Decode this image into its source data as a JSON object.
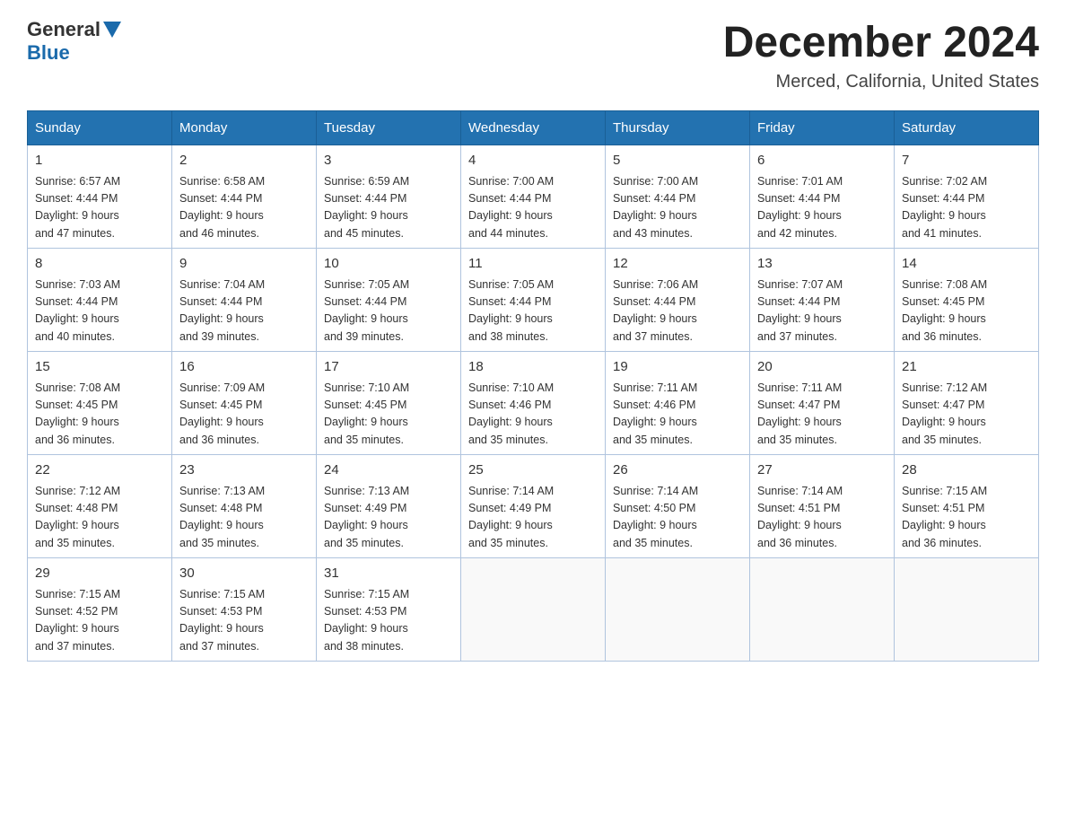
{
  "header": {
    "logo_general": "General",
    "logo_blue": "Blue",
    "month_title": "December 2024",
    "location": "Merced, California, United States"
  },
  "days_of_week": [
    "Sunday",
    "Monday",
    "Tuesday",
    "Wednesday",
    "Thursday",
    "Friday",
    "Saturday"
  ],
  "weeks": [
    [
      {
        "day": "1",
        "sunrise": "6:57 AM",
        "sunset": "4:44 PM",
        "daylight": "9 hours and 47 minutes."
      },
      {
        "day": "2",
        "sunrise": "6:58 AM",
        "sunset": "4:44 PM",
        "daylight": "9 hours and 46 minutes."
      },
      {
        "day": "3",
        "sunrise": "6:59 AM",
        "sunset": "4:44 PM",
        "daylight": "9 hours and 45 minutes."
      },
      {
        "day": "4",
        "sunrise": "7:00 AM",
        "sunset": "4:44 PM",
        "daylight": "9 hours and 44 minutes."
      },
      {
        "day": "5",
        "sunrise": "7:00 AM",
        "sunset": "4:44 PM",
        "daylight": "9 hours and 43 minutes."
      },
      {
        "day": "6",
        "sunrise": "7:01 AM",
        "sunset": "4:44 PM",
        "daylight": "9 hours and 42 minutes."
      },
      {
        "day": "7",
        "sunrise": "7:02 AM",
        "sunset": "4:44 PM",
        "daylight": "9 hours and 41 minutes."
      }
    ],
    [
      {
        "day": "8",
        "sunrise": "7:03 AM",
        "sunset": "4:44 PM",
        "daylight": "9 hours and 40 minutes."
      },
      {
        "day": "9",
        "sunrise": "7:04 AM",
        "sunset": "4:44 PM",
        "daylight": "9 hours and 39 minutes."
      },
      {
        "day": "10",
        "sunrise": "7:05 AM",
        "sunset": "4:44 PM",
        "daylight": "9 hours and 39 minutes."
      },
      {
        "day": "11",
        "sunrise": "7:05 AM",
        "sunset": "4:44 PM",
        "daylight": "9 hours and 38 minutes."
      },
      {
        "day": "12",
        "sunrise": "7:06 AM",
        "sunset": "4:44 PM",
        "daylight": "9 hours and 37 minutes."
      },
      {
        "day": "13",
        "sunrise": "7:07 AM",
        "sunset": "4:44 PM",
        "daylight": "9 hours and 37 minutes."
      },
      {
        "day": "14",
        "sunrise": "7:08 AM",
        "sunset": "4:45 PM",
        "daylight": "9 hours and 36 minutes."
      }
    ],
    [
      {
        "day": "15",
        "sunrise": "7:08 AM",
        "sunset": "4:45 PM",
        "daylight": "9 hours and 36 minutes."
      },
      {
        "day": "16",
        "sunrise": "7:09 AM",
        "sunset": "4:45 PM",
        "daylight": "9 hours and 36 minutes."
      },
      {
        "day": "17",
        "sunrise": "7:10 AM",
        "sunset": "4:45 PM",
        "daylight": "9 hours and 35 minutes."
      },
      {
        "day": "18",
        "sunrise": "7:10 AM",
        "sunset": "4:46 PM",
        "daylight": "9 hours and 35 minutes."
      },
      {
        "day": "19",
        "sunrise": "7:11 AM",
        "sunset": "4:46 PM",
        "daylight": "9 hours and 35 minutes."
      },
      {
        "day": "20",
        "sunrise": "7:11 AM",
        "sunset": "4:47 PM",
        "daylight": "9 hours and 35 minutes."
      },
      {
        "day": "21",
        "sunrise": "7:12 AM",
        "sunset": "4:47 PM",
        "daylight": "9 hours and 35 minutes."
      }
    ],
    [
      {
        "day": "22",
        "sunrise": "7:12 AM",
        "sunset": "4:48 PM",
        "daylight": "9 hours and 35 minutes."
      },
      {
        "day": "23",
        "sunrise": "7:13 AM",
        "sunset": "4:48 PM",
        "daylight": "9 hours and 35 minutes."
      },
      {
        "day": "24",
        "sunrise": "7:13 AM",
        "sunset": "4:49 PM",
        "daylight": "9 hours and 35 minutes."
      },
      {
        "day": "25",
        "sunrise": "7:14 AM",
        "sunset": "4:49 PM",
        "daylight": "9 hours and 35 minutes."
      },
      {
        "day": "26",
        "sunrise": "7:14 AM",
        "sunset": "4:50 PM",
        "daylight": "9 hours and 35 minutes."
      },
      {
        "day": "27",
        "sunrise": "7:14 AM",
        "sunset": "4:51 PM",
        "daylight": "9 hours and 36 minutes."
      },
      {
        "day": "28",
        "sunrise": "7:15 AM",
        "sunset": "4:51 PM",
        "daylight": "9 hours and 36 minutes."
      }
    ],
    [
      {
        "day": "29",
        "sunrise": "7:15 AM",
        "sunset": "4:52 PM",
        "daylight": "9 hours and 37 minutes."
      },
      {
        "day": "30",
        "sunrise": "7:15 AM",
        "sunset": "4:53 PM",
        "daylight": "9 hours and 37 minutes."
      },
      {
        "day": "31",
        "sunrise": "7:15 AM",
        "sunset": "4:53 PM",
        "daylight": "9 hours and 38 minutes."
      },
      null,
      null,
      null,
      null
    ]
  ],
  "labels": {
    "sunrise_prefix": "Sunrise: ",
    "sunset_prefix": "Sunset: ",
    "daylight_prefix": "Daylight: "
  }
}
